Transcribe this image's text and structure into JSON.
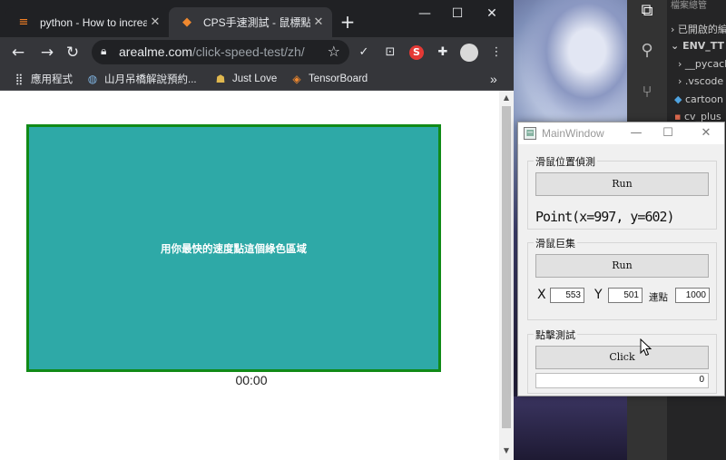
{
  "chrome": {
    "tabs": [
      {
        "title": "python - How to increa",
        "icon": "stackoverflow-icon",
        "active": false
      },
      {
        "title": "CPS手速測試 - 鼠標點擊",
        "icon": "fox-icon",
        "active": true
      }
    ],
    "address": {
      "domain": "arealme.com",
      "path": "/click-speed-test/zh/"
    },
    "bookmarks": [
      {
        "label": "應用程式",
        "icon": "apps-grid-icon"
      },
      {
        "label": "山月吊橋解說預約...",
        "icon": "globe-icon"
      },
      {
        "label": "Just Love",
        "icon": "people-icon"
      },
      {
        "label": "TensorBoard",
        "icon": "tensorflow-icon"
      }
    ],
    "overflow": "»"
  },
  "page": {
    "click_area_text": "用你最快的速度點這個綠色區域",
    "timer": "00:00"
  },
  "vscode": {
    "explorer_header": "檔案總管",
    "items": [
      {
        "label": "已開啟的編輯器",
        "chevron": "›"
      },
      {
        "label": "ENV_TT",
        "chevron": "⌄"
      },
      {
        "label": "__pycache__",
        "chevron": "›"
      },
      {
        "label": ".vscode",
        "chevron": "›"
      },
      {
        "label": "cartoon",
        "chevron": ""
      },
      {
        "label": "cv_plus",
        "chevron": ""
      }
    ]
  },
  "qt": {
    "window_title": "MainWindow",
    "group_position": {
      "title": "滑鼠位置偵測",
      "button": "Run",
      "point_text": "Point(x=997, y=602)"
    },
    "group_move": {
      "title": "滑鼠巨集",
      "button": "Run",
      "x_label": "X",
      "x_value": "553",
      "y_label": "Y",
      "y_value": "501",
      "repeat_label": "連點",
      "repeat_value": "1000"
    },
    "group_click": {
      "title": "點擊測試",
      "button": "Click",
      "progress_value": "0",
      "progress_fraction": 0
    }
  },
  "colors": {
    "click_area": "#2ea9a7",
    "click_border": "#108a17",
    "chrome_dark": "#35363a"
  }
}
